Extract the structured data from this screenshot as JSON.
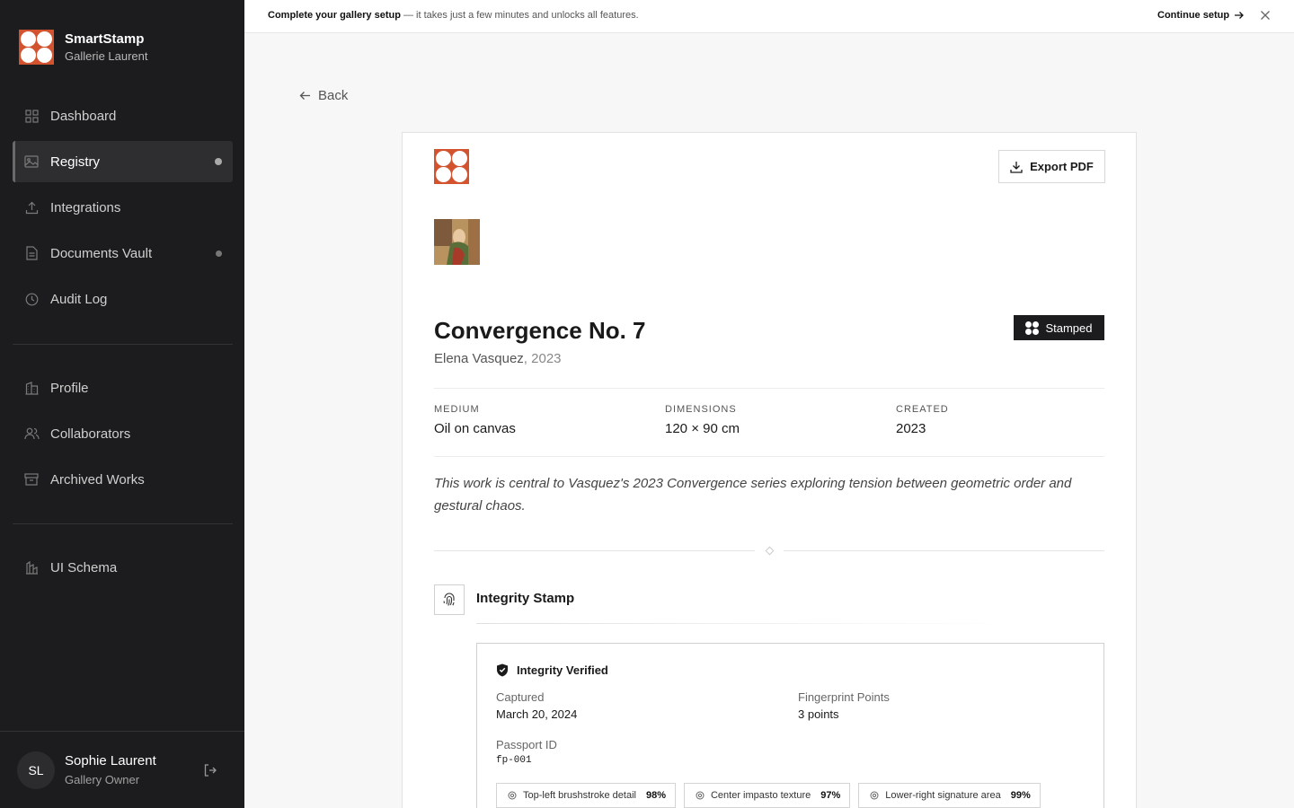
{
  "brand": {
    "name": "SmartStamp",
    "gallery": "Gallerie Laurent"
  },
  "nav": {
    "primary": [
      {
        "label": "Dashboard",
        "icon": "grid-icon"
      },
      {
        "label": "Registry",
        "icon": "image-icon",
        "active": true
      },
      {
        "label": "Integrations",
        "icon": "upload-icon"
      },
      {
        "label": "Documents Vault",
        "icon": "document-icon"
      },
      {
        "label": "Audit Log",
        "icon": "clock-icon"
      }
    ],
    "secondary": [
      {
        "label": "Profile",
        "icon": "building-icon"
      },
      {
        "label": "Collaborators",
        "icon": "users-icon"
      },
      {
        "label": "Archived Works",
        "icon": "archive-icon"
      }
    ],
    "tertiary": [
      {
        "label": "UI Schema",
        "icon": "schema-icon"
      }
    ]
  },
  "user": {
    "initials": "SL",
    "name": "Sophie Laurent",
    "role": "Gallery Owner"
  },
  "banner": {
    "bold": "Complete your gallery setup",
    "rest": " — it takes just a few minutes and unlocks all features.",
    "cta": "Continue setup"
  },
  "back_label": "Back",
  "card": {
    "export_label": "Export PDF",
    "title": "Convergence No. 7",
    "artist": "Elena Vasquez",
    "year_suffix": ", 2023",
    "status": "Stamped",
    "meta": [
      {
        "key": "MEDIUM",
        "value": "Oil on canvas"
      },
      {
        "key": "DIMENSIONS",
        "value": "120 × 90 cm"
      },
      {
        "key": "CREATED",
        "value": "2023"
      }
    ],
    "description": "This work is central to Vasquez's 2023 Convergence series exploring tension between geometric order and gestural chaos.",
    "stamp_section_title": "Integrity Stamp",
    "verify": {
      "heading": "Integrity Verified",
      "captured_label": "Captured",
      "captured_value": "March 20, 2024",
      "points_label": "Fingerprint Points",
      "points_value": "3 points",
      "passport_label": "Passport ID",
      "passport_value": "fp-001",
      "chips": [
        {
          "label": "Top-left brushstroke detail",
          "pct": "98%"
        },
        {
          "label": "Center impasto texture",
          "pct": "97%"
        },
        {
          "label": "Lower-right signature area",
          "pct": "99%"
        }
      ]
    }
  },
  "colors": {
    "brand": "#d4532f",
    "sidebar": "#1c1c1e"
  }
}
